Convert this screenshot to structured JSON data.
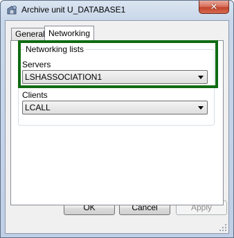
{
  "window": {
    "title": "Archive unit U_DATABASE1",
    "close_glyph": "✕"
  },
  "tabs": [
    {
      "label": "General",
      "active": false
    },
    {
      "label": "Networking",
      "active": true
    }
  ],
  "networking": {
    "group_title": "Networking lists",
    "servers_label": "Servers",
    "servers_value": "LSHASSOCIATION1",
    "clients_label": "Clients",
    "clients_value": "LCALL"
  },
  "buttons": {
    "ok": "OK",
    "cancel": "Cancel",
    "apply": "Apply"
  },
  "colors": {
    "highlight": "#0f6b12",
    "titlebar": "#c9d7ea",
    "close": "#c2452e"
  },
  "icons": {
    "app": "archive-icon",
    "close": "close-icon",
    "dropdown": "chevron-down-icon",
    "grip": "resize-grip-icon"
  }
}
